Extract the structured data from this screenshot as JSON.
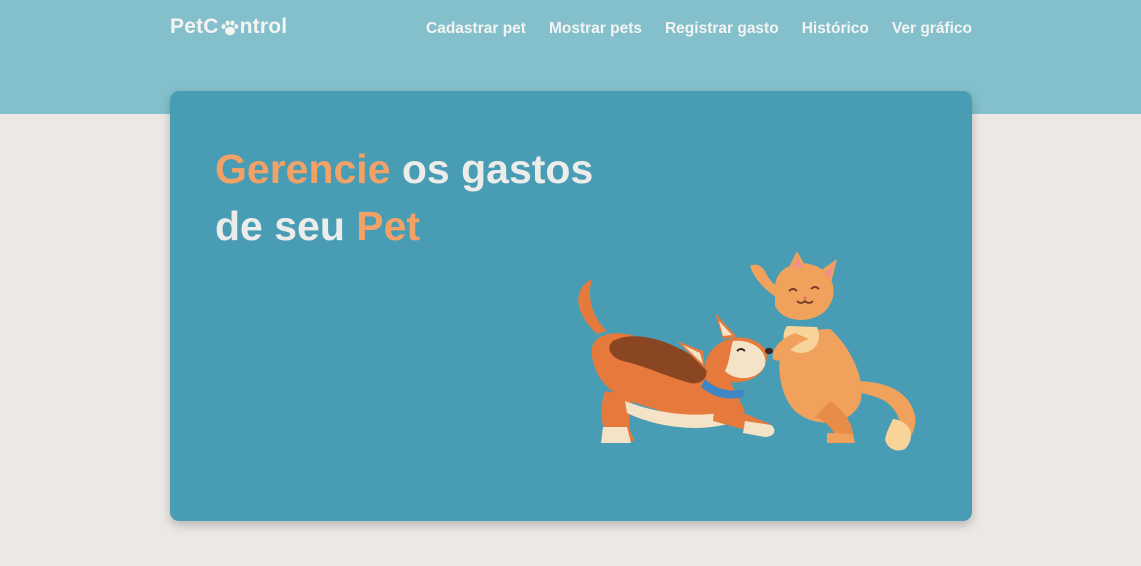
{
  "header": {
    "logo_prefix": "PetC",
    "logo_icon": "paw-icon",
    "logo_suffix": "ntrol",
    "nav": [
      {
        "label": "Cadastrar pet"
      },
      {
        "label": "Mostrar pets"
      },
      {
        "label": "Registrar gasto"
      },
      {
        "label": "Histórico"
      },
      {
        "label": "Ver gráfico"
      }
    ]
  },
  "hero": {
    "line1_highlight": "Gerencie",
    "line1_rest": " os gastos",
    "line2_start": "de seu ",
    "line2_highlight": "Pet",
    "illustration": "dog-and-cat-playing-illustration"
  },
  "colors": {
    "header_bg": "#84c0cc",
    "page_bg": "#ece8e5",
    "hero_bg": "#489db5",
    "accent": "#f2a267",
    "text_light": "#ececea"
  }
}
